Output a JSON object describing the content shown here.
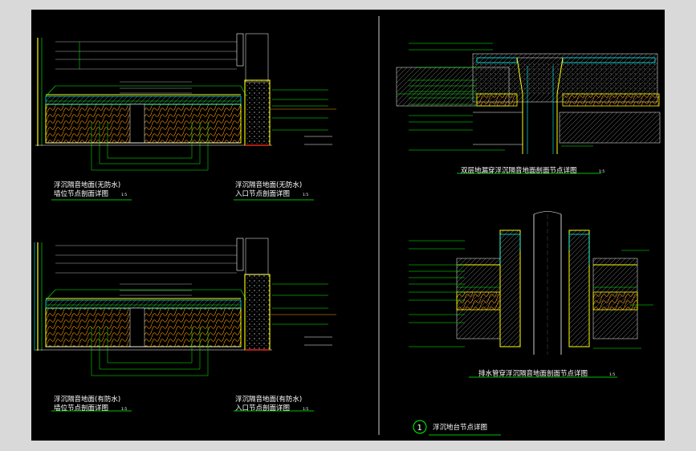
{
  "drawing": {
    "title_1": "浮沉隔音地面(无防水)",
    "title_1b": "墙位节点剖面详图",
    "title_2": "浮沉隔音地面(无防水)",
    "title_2b": "入口节点剖面详图",
    "title_3": "浮沉隔音地面(有防水)",
    "title_3b": "墙位节点剖面详图",
    "title_4": "浮沉隔音地面(有防水)",
    "title_4b": "入口节点剖面详图",
    "title_5": "双层地漏穿浮沉隔音地面剖面节点详图",
    "title_6": "排水管穿浮沉隔音地面剖面节点详图",
    "scale": "1:5",
    "index_number": "1",
    "index_title": "浮沉地台节点详图"
  },
  "colors": {
    "background": "#000000",
    "frame": "#d9d9d9",
    "yellow": "#ffff00",
    "green": "#00ff00",
    "cyan": "#00ffff",
    "white": "#ffffff",
    "red": "#ff2020",
    "orange": "#ff9900"
  }
}
